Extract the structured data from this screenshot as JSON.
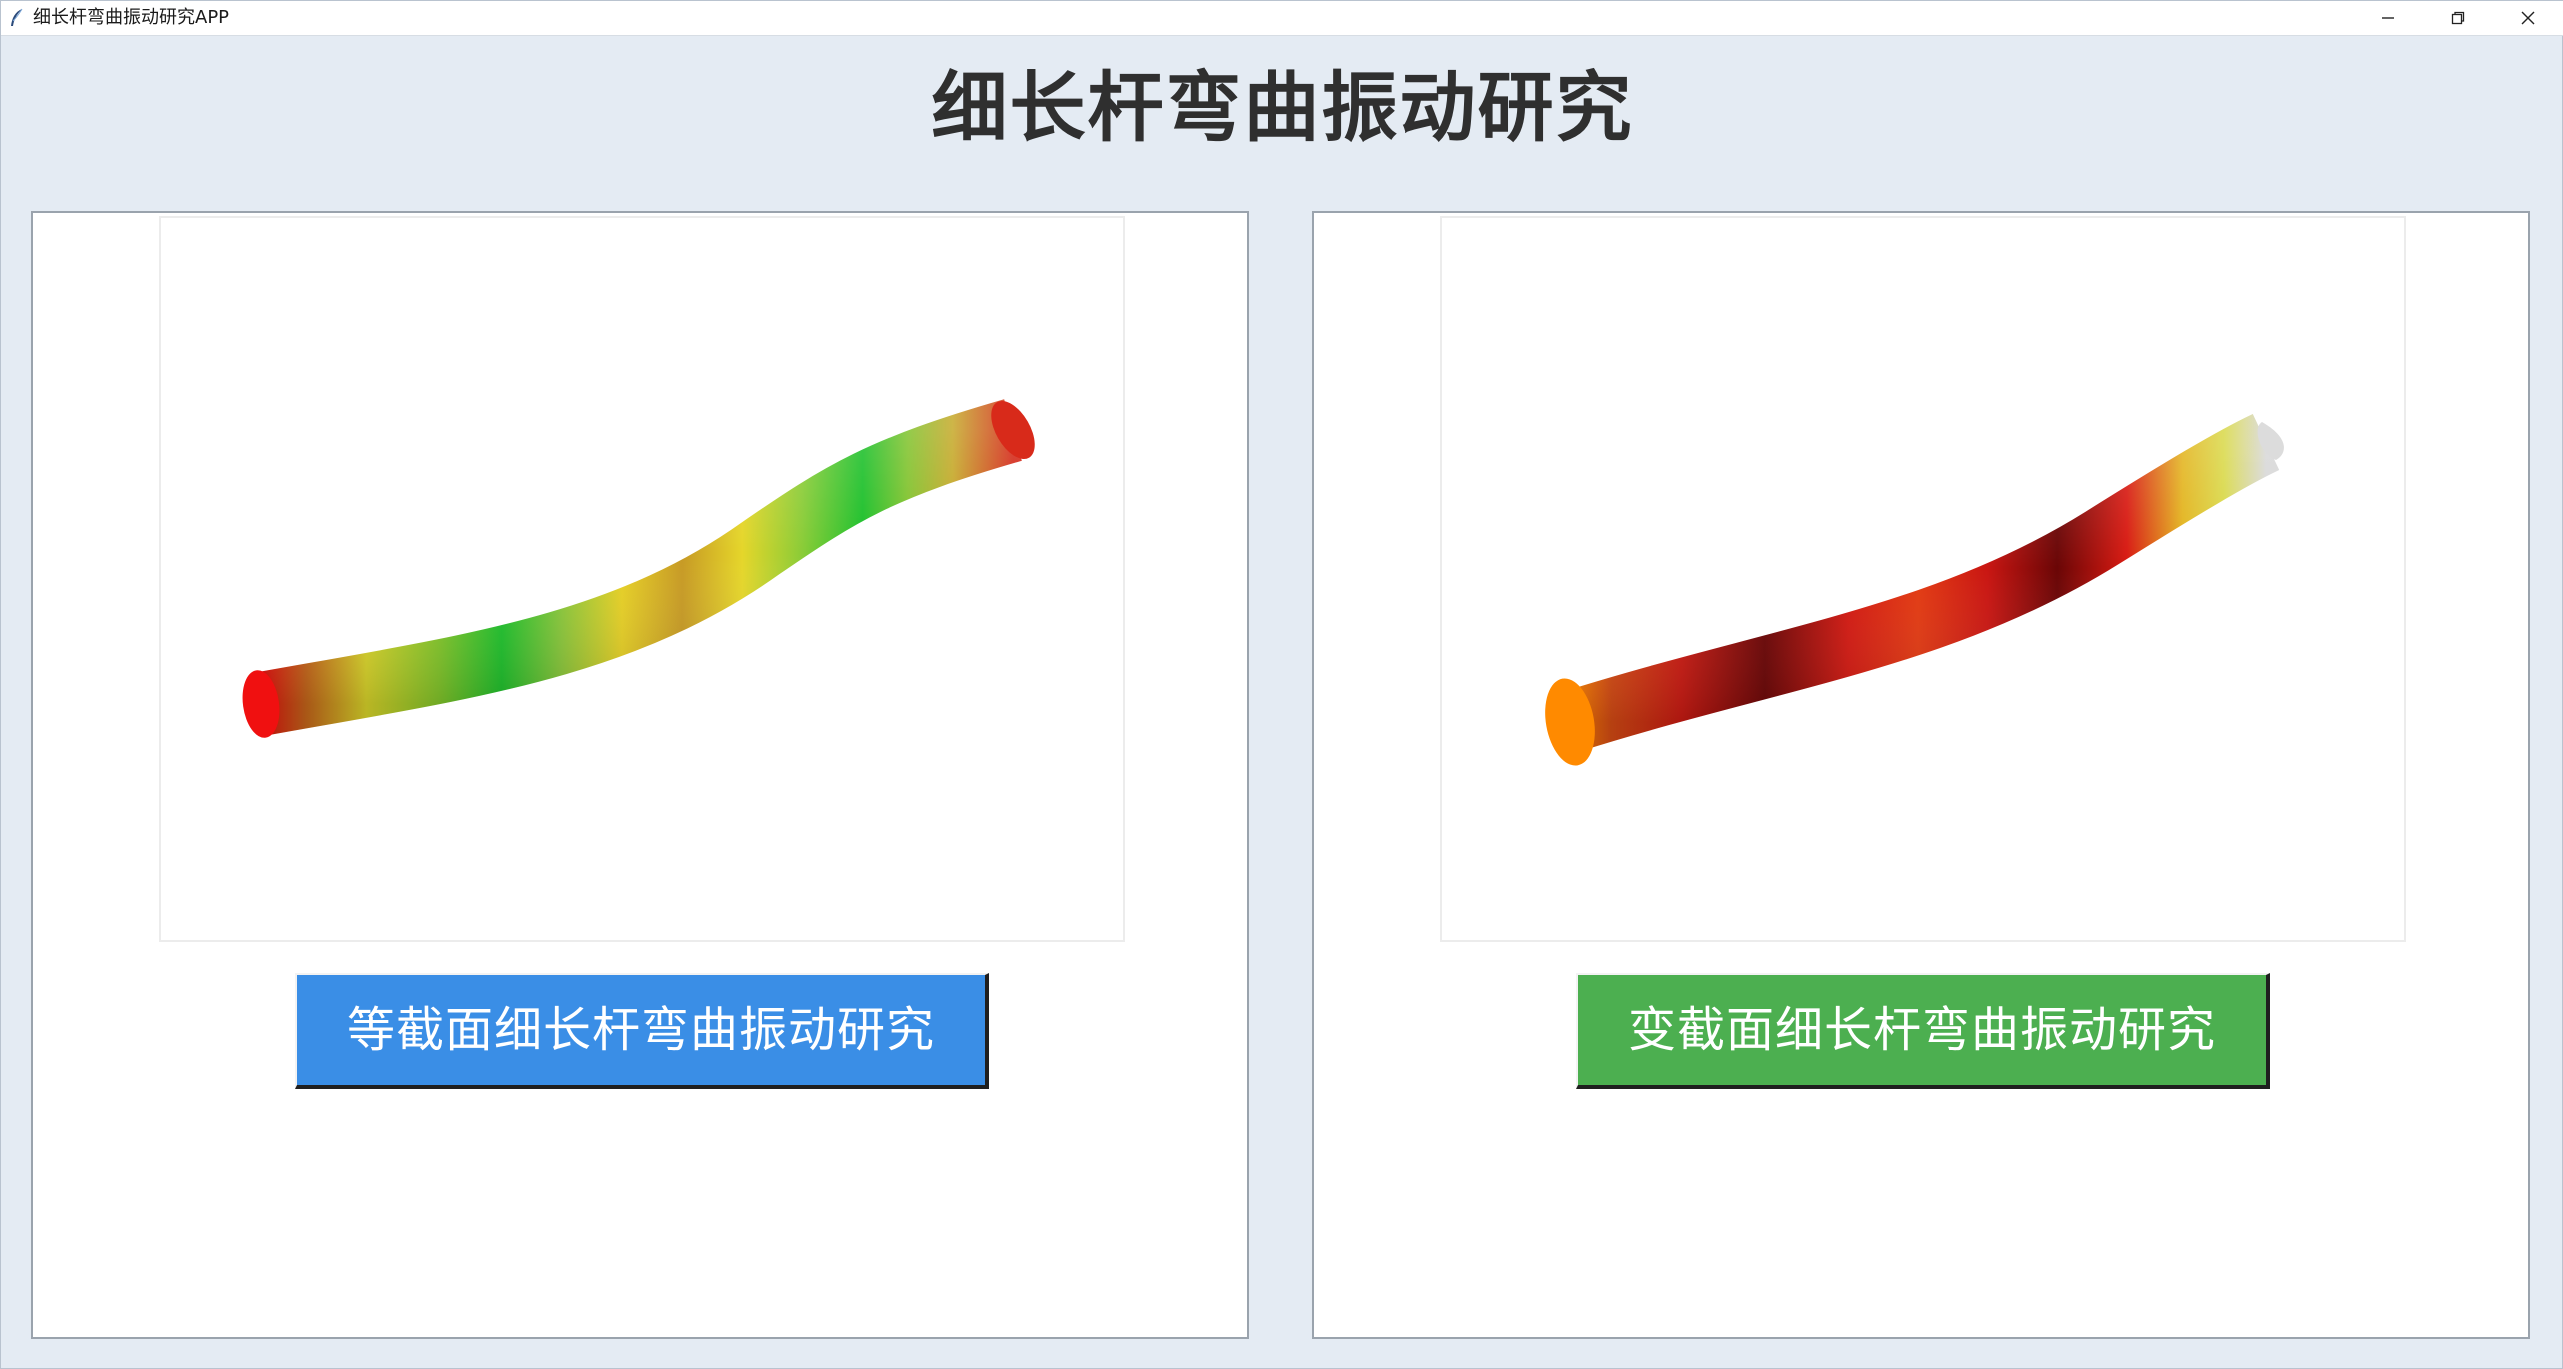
{
  "window": {
    "title": "细长杆弯曲振动研究APP",
    "controls": {
      "minimize": "minimize-icon",
      "restore": "restore-icon",
      "close": "close-icon"
    }
  },
  "header": {
    "title": "细长杆弯曲振动研究"
  },
  "panels": [
    {
      "image": "uniform-section-rod-vibration-render",
      "button_label": "等截面细长杆弯曲振动研究",
      "button_color": "#3a8ee6"
    },
    {
      "image": "variable-section-rod-vibration-render",
      "button_label": "变截面细长杆弯曲振动研究",
      "button_color": "#4caf50"
    }
  ],
  "colors": {
    "background": "#e4ebf3",
    "panel": "#ffffff",
    "heading": "#2f2f2f"
  }
}
